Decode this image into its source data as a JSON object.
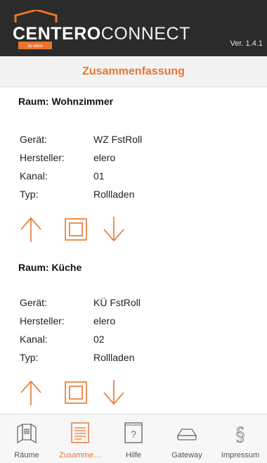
{
  "header": {
    "logo_bold": "CENTERO",
    "logo_light": "CONNECT",
    "logo_byline": "by elero",
    "version": "Ver. 1.4.1"
  },
  "title": "Zusammenfassung",
  "labels": {
    "device": "Gerät:",
    "manufacturer": "Hersteller:",
    "channel": "Kanal:",
    "type": "Typ:"
  },
  "rooms": [
    {
      "title": "Raum: Wohnzimmer",
      "device": "WZ FstRoll",
      "manufacturer": "elero",
      "channel": "01",
      "type": "Rollladen"
    },
    {
      "title": "Raum: Küche",
      "device": "KÜ FstRoll",
      "manufacturer": "elero",
      "channel": "02",
      "type": "Rollladen"
    }
  ],
  "tabs": [
    {
      "label": "Räume",
      "icon": "rooms-icon"
    },
    {
      "label": "Zusamme…",
      "icon": "summary-icon",
      "active": true
    },
    {
      "label": "Hilfe",
      "icon": "help-icon"
    },
    {
      "label": "Gateway",
      "icon": "gateway-icon"
    },
    {
      "label": "Impressum",
      "icon": "paragraph-icon"
    }
  ],
  "colors": {
    "accent": "#e8742f",
    "header_bg": "#2b2b2b",
    "icon_gray": "#6b6b6b"
  }
}
